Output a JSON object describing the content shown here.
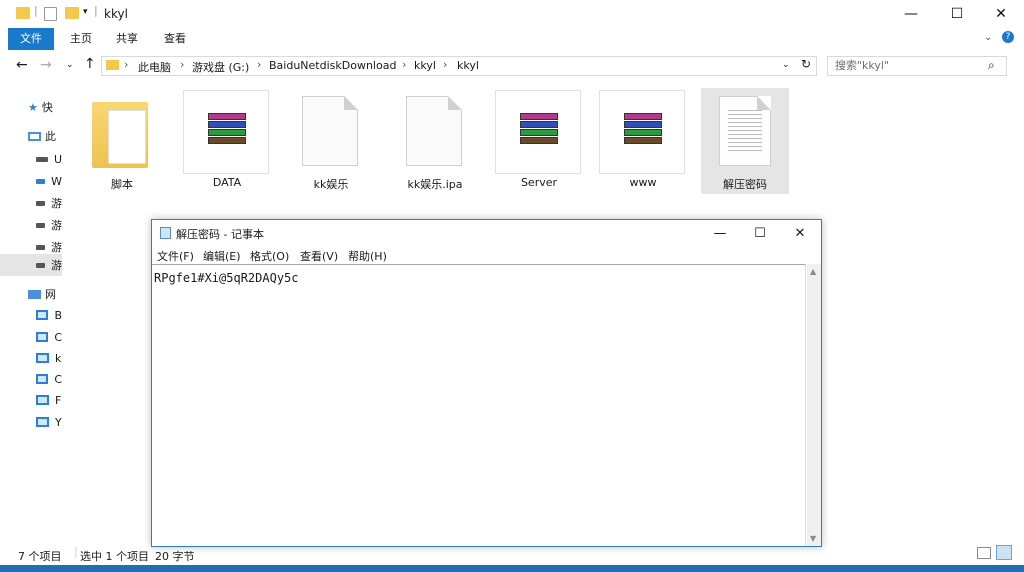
{
  "window": {
    "title": "kkyl"
  },
  "ribbon": {
    "tabs": [
      "文件",
      "主页",
      "共享",
      "查看"
    ]
  },
  "address": {
    "crumbs": [
      "此电脑",
      "游戏盘 (G:)",
      "BaiduNetdiskDownload",
      "kkyl",
      "kkyl"
    ],
    "search_placeholder": "搜索\"kkyl\""
  },
  "nav": {
    "items": [
      "快",
      "此",
      "U",
      "W",
      "游",
      "游",
      "游",
      "游",
      "网",
      "B",
      "C",
      "k",
      "C",
      "F",
      "Y"
    ]
  },
  "files": [
    {
      "name": "脚本",
      "icon": "folder-icon"
    },
    {
      "name": "DATA",
      "icon": "winrar-icon"
    },
    {
      "name": "kk娱乐",
      "icon": "document-icon"
    },
    {
      "name": "kk娱乐.ipa",
      "icon": "document-icon"
    },
    {
      "name": "Server",
      "icon": "winrar-icon"
    },
    {
      "name": "www",
      "icon": "winrar-icon"
    },
    {
      "name": "解压密码",
      "icon": "text-file-icon"
    }
  ],
  "notepad": {
    "title": "解压密码 - 记事本",
    "menu": [
      "文件(F)",
      "编辑(E)",
      "格式(O)",
      "查看(V)",
      "帮助(H)"
    ],
    "content": "RPgfe1#Xi@5qR2DAQy5c"
  },
  "status": {
    "count": "7 个项目",
    "selected": "选中 1 个项目",
    "size": "20 字节"
  },
  "colors": {
    "accent": "#1979ca",
    "selection": "#e5e5e5"
  }
}
